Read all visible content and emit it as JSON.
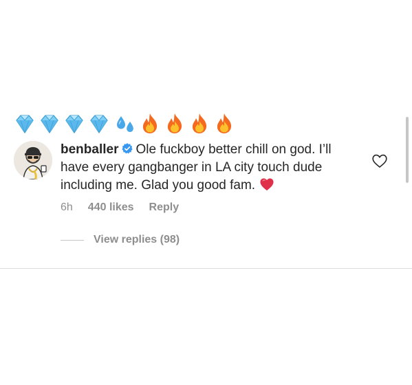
{
  "emoji_row": [
    "gem-stone",
    "gem-stone",
    "gem-stone",
    "gem-stone",
    "sweat-droplets",
    "fire",
    "fire",
    "fire",
    "fire"
  ],
  "comment": {
    "username": "benballer",
    "verified": true,
    "text": "Ole fuckboy better chill on god. I’ll have every gangbanger in LA city touch dude including me. Glad you good fam.",
    "trailing_emoji": "red-heart",
    "time": "6h",
    "likes": "440 likes",
    "reply_label": "Reply"
  },
  "replies": {
    "label": "View replies (98)"
  },
  "colors": {
    "text": "#262626",
    "secondary_text": "#8e8e8e",
    "verified_blue": "#3897f0",
    "heart_red": "#e0314b",
    "fire_orange": "#f48120",
    "gem_blue": "#6fc3f0"
  }
}
